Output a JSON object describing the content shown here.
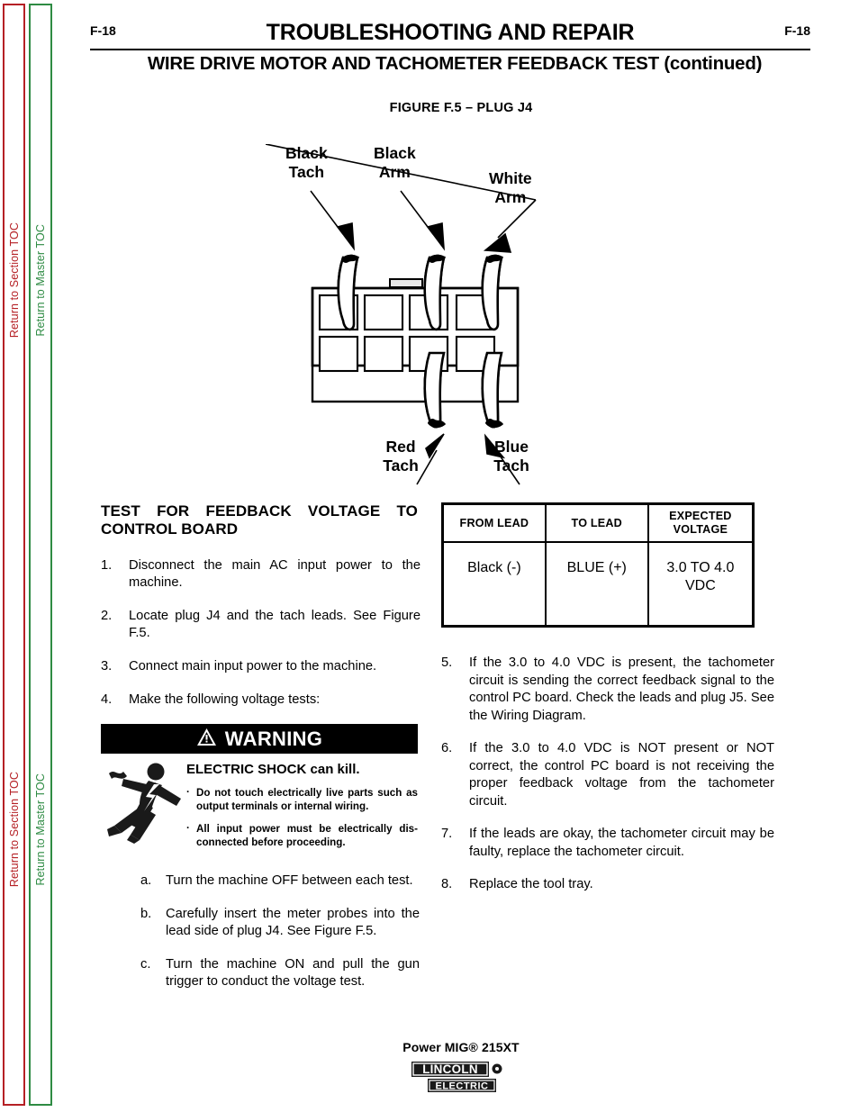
{
  "sidebar": {
    "section_toc": {
      "label": "Return to Section TOC",
      "color": "#b52025"
    },
    "master_toc": {
      "label": "Return to Master TOC",
      "color": "#2e8b43"
    }
  },
  "header": {
    "folio_left": "F-18",
    "folio_right": "F-18",
    "title": "TROUBLESHOOTING AND REPAIR",
    "subtitle": "WIRE DRIVE MOTOR AND TACHOMETER FEEDBACK TEST (continued)"
  },
  "figure": {
    "caption": "FIGURE F.5 – PLUG J4",
    "labels": {
      "black_tach_line1": "Black",
      "black_tach_line2": "Tach",
      "black_arm_line1": "Black",
      "black_arm_line2": "Arm",
      "white_arm_line1": "White",
      "white_arm_line2": "Arm",
      "red_tach_line1": "Red",
      "red_tach_line2": "Tach",
      "blue_tach_line1": "Blue",
      "blue_tach_line2": "Tach"
    }
  },
  "left_column": {
    "section_heading_line1": "TEST  FOR  FEEDBACK  VOLTAGE  TO",
    "section_heading_line2": "CONTROL  BOARD",
    "steps": [
      {
        "marker": "1.",
        "text": "Disconnect  the  main  AC  input  power  to  the  machine."
      },
      {
        "marker": "2.",
        "text": "Locate  plug  J4  and  the  tach  leads.   See  Figure  F.5."
      },
      {
        "marker": "3.",
        "text": "Connect  main  input  power  to  the  machine."
      },
      {
        "marker": "4.",
        "text": "Make  the  following  voltage  tests:"
      }
    ],
    "substeps": [
      {
        "marker": "a.",
        "text": "Turn  the  machine  OFF  between  each  test."
      },
      {
        "marker": "b.",
        "text": "Carefully  insert  the  meter  probes  into  the  lead  side  of  plug  J4.   See  Figure  F.5."
      },
      {
        "marker": "c.",
        "text": "Turn  the  machine  ON  and  pull  the  gun  trigger  to  conduct  the  voltage  test."
      }
    ]
  },
  "warning": {
    "banner_label": "WARNING",
    "warning_icon": "warning-triangle-icon",
    "shock_icon": "electric-shock-icon",
    "headline": "ELECTRIC SHOCK can kill.",
    "bullets": [
      "Do not touch electrically live parts such as output terminals or internal wiring.",
      "All input power must be electrically dis-connected before proceeding."
    ],
    "bullet_marker": "·"
  },
  "table": {
    "headers": [
      "FROM LEAD",
      "TO LEAD",
      "EXPECTED VOLTAGE"
    ],
    "header_expected_line1": "EXPECTED",
    "header_expected_line2": "VOLTAGE",
    "rows": [
      {
        "from_lead": "Black (-)",
        "to_lead": "BLUE (+)",
        "expected_voltage": "3.0 TO 4.0 VDC"
      }
    ]
  },
  "right_column": {
    "steps": [
      {
        "marker": "5.",
        "text": "If the 3.0 to 4.0 VDC is present, the tachometer circuit is sending the correct feedback signal to the control PC board.   Check the leads and plug J5.   See the Wiring Diagram."
      },
      {
        "marker": "6.",
        "text": "If the 3.0 to 4.0 VDC is NOT present or NOT correct, the control PC board is not receiving the proper feedback voltage from the tachometer  circuit."
      },
      {
        "marker": "7.",
        "text": "If  the  leads  are  okay,  the  tachometer  circuit may  be  faulty,  replace  the  tachometer  circuit."
      },
      {
        "marker": "8.",
        "text": "Replace  the  tool  tray."
      }
    ]
  },
  "footer": {
    "product": "Power MIG® 215XT",
    "logo_top": "LINCOLN",
    "logo_bottom": "ELECTRIC",
    "logo_mark": "®"
  }
}
